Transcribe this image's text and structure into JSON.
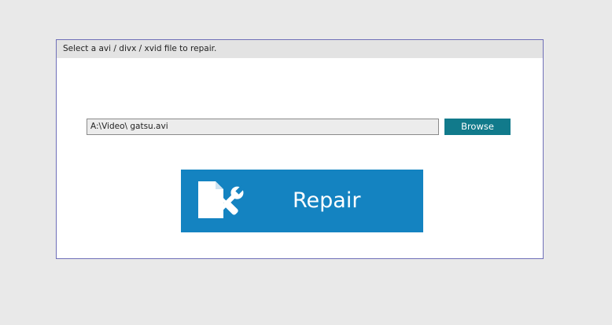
{
  "dialog": {
    "instruction": "Select a avi / divx / xvid file to repair."
  },
  "file_picker": {
    "path_value": "A:\\Video\\ gatsu.avi",
    "browse_label": "Browse"
  },
  "repair": {
    "label": "Repair",
    "icon": "file-repair-tools-icon"
  },
  "colors": {
    "background": "#e9e9e9",
    "panel_border": "#6f6fb8",
    "header_background": "#e3e3e3",
    "browse_button": "#117a8b",
    "repair_button": "#1483c1"
  }
}
